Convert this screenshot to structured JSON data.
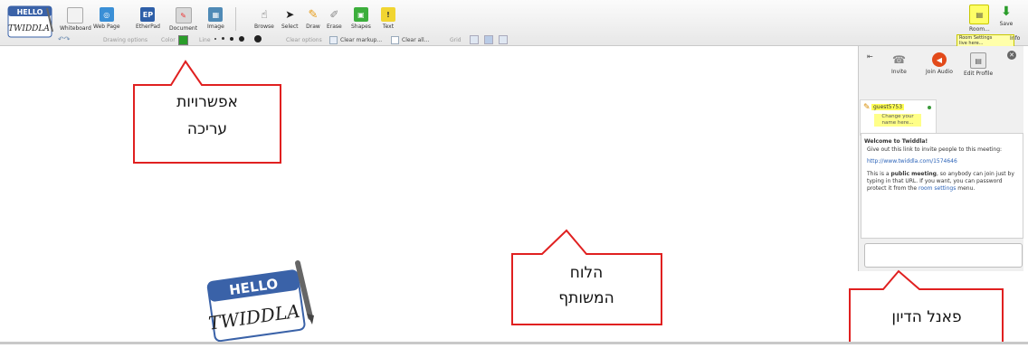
{
  "logo": {
    "top": "HELLO",
    "name": "TWIDDLA"
  },
  "toolbar": {
    "tools": [
      {
        "label": "Whiteboard",
        "icon": "whiteboard-icon",
        "color": "#dcdcdc"
      },
      {
        "label": "Web Page",
        "icon": "web-page-icon",
        "color": "#3a8fd6"
      },
      {
        "label": "EtherPad",
        "icon": "etherpad-icon",
        "color": "#2e5fa8",
        "glyph": "EP"
      },
      {
        "label": "Document",
        "icon": "document-icon",
        "color": "#b9b9b9"
      },
      {
        "label": "Image",
        "icon": "image-icon",
        "color": "#4f8ab6"
      },
      {
        "label": "Browse",
        "icon": "browse-icon"
      },
      {
        "label": "Select",
        "icon": "select-icon"
      },
      {
        "label": "Draw",
        "icon": "draw-icon"
      },
      {
        "label": "Erase",
        "icon": "erase-icon"
      },
      {
        "label": "Shapes",
        "icon": "shapes-icon"
      },
      {
        "label": "Text",
        "icon": "text-icon"
      }
    ],
    "room_label": "Room...",
    "save_label": "Save",
    "room_tooltip": "Room Settings\nlive here...",
    "info_label": "Info"
  },
  "options": {
    "drawing_options": "Drawing options",
    "color_label": "Color",
    "line_label": "Line",
    "clear_options": "Clear options",
    "clear_markup": "Clear markup...",
    "clear_all": "Clear all...",
    "grid_label": "Grid"
  },
  "panel": {
    "invite_label": "Invite",
    "join_audio_label": "Join Audio",
    "edit_profile_label": "Edit Profile",
    "guest_name": "guest5753",
    "change_name": "Change your\nname here...",
    "welcome_title": "Welcome to Twiddla!",
    "welcome_line": "Give out this link to invite people to this meeting:",
    "meeting_link": "http://www.twiddla.com/1574646",
    "public_text_1": "This is a",
    "public_bold": "public meeting",
    "public_text_2": ", so anybody can join just by typing in that URL. If you want, you can password protect it from the",
    "room_settings_link": "room settings",
    "public_text_3": "menu."
  },
  "callouts": {
    "editing_options": "אפשרויות\nעריכה",
    "shared_board": "הלוח\nהמשותף",
    "discussion_panel": "פאנל הדיון"
  },
  "colors": {
    "callout_border": "#e02020",
    "highlight": "#ffff66",
    "link": "#2a62b8",
    "accent_green": "#2a9d2a"
  }
}
